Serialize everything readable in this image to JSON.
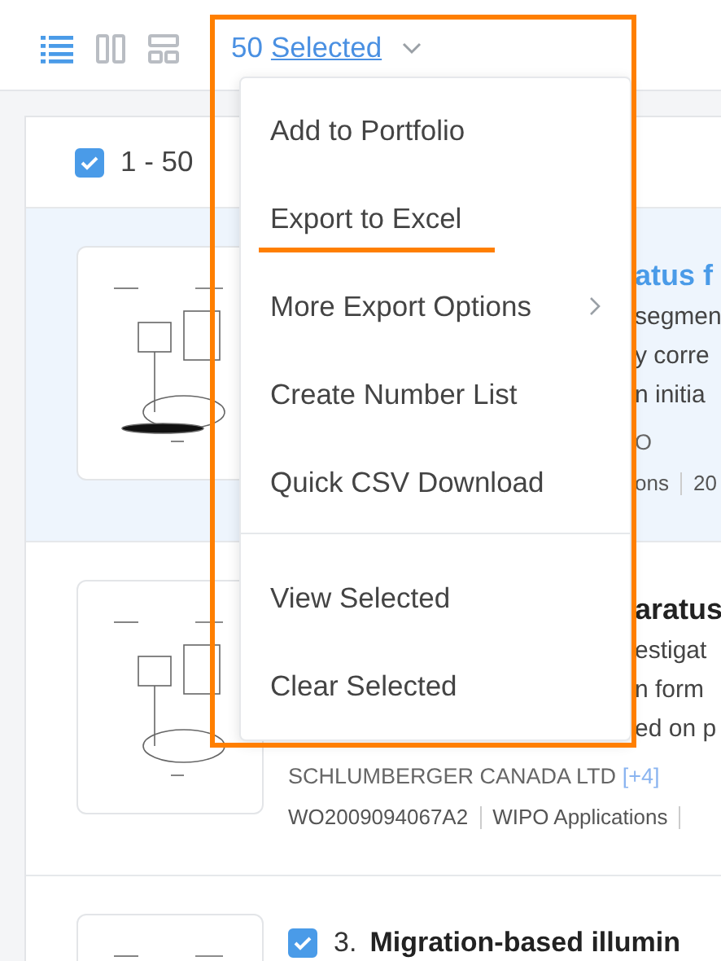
{
  "toolbar": {
    "view_buttons": [
      {
        "kind": "list",
        "selected": true
      },
      {
        "kind": "columns",
        "selected": false
      },
      {
        "kind": "grid",
        "selected": false
      }
    ],
    "selection": {
      "count": "50",
      "label": "Selected"
    }
  },
  "results_header": {
    "checked": true,
    "range": "1 - 50"
  },
  "results": [
    {
      "highlighted": true,
      "title": "atus f",
      "snippet_lines": [
        "segmen",
        "y corre",
        "n initia"
      ],
      "assignee": "O",
      "meta": [
        "ons",
        "20"
      ]
    },
    {
      "highlighted": false,
      "title": "aratus",
      "snippet_lines": [
        "estigat",
        "n form",
        "ed on p"
      ],
      "assignee": "SCHLUMBERGER CANADA LTD",
      "assignee_more": "[+4]",
      "meta": [
        "WO2009094067A2",
        "WIPO Applications"
      ],
      "meta_continues": true
    },
    {
      "highlighted": false,
      "checked": true,
      "number": "3.",
      "title": "Migration-based illumin"
    }
  ],
  "menu": {
    "outlined": true,
    "groups": [
      [
        {
          "label": "Add to Portfolio",
          "submenu": false,
          "marked": false
        },
        {
          "label": "Export to Excel",
          "submenu": false,
          "marked": true
        },
        {
          "label": "More Export Options",
          "submenu": true,
          "marked": false
        },
        {
          "label": "Create Number List",
          "submenu": false,
          "marked": false
        },
        {
          "label": "Quick CSV Download",
          "submenu": false,
          "marked": false
        }
      ],
      [
        {
          "label": "View Selected",
          "submenu": false,
          "marked": false
        },
        {
          "label": "Clear Selected",
          "submenu": false,
          "marked": false
        }
      ]
    ]
  }
}
